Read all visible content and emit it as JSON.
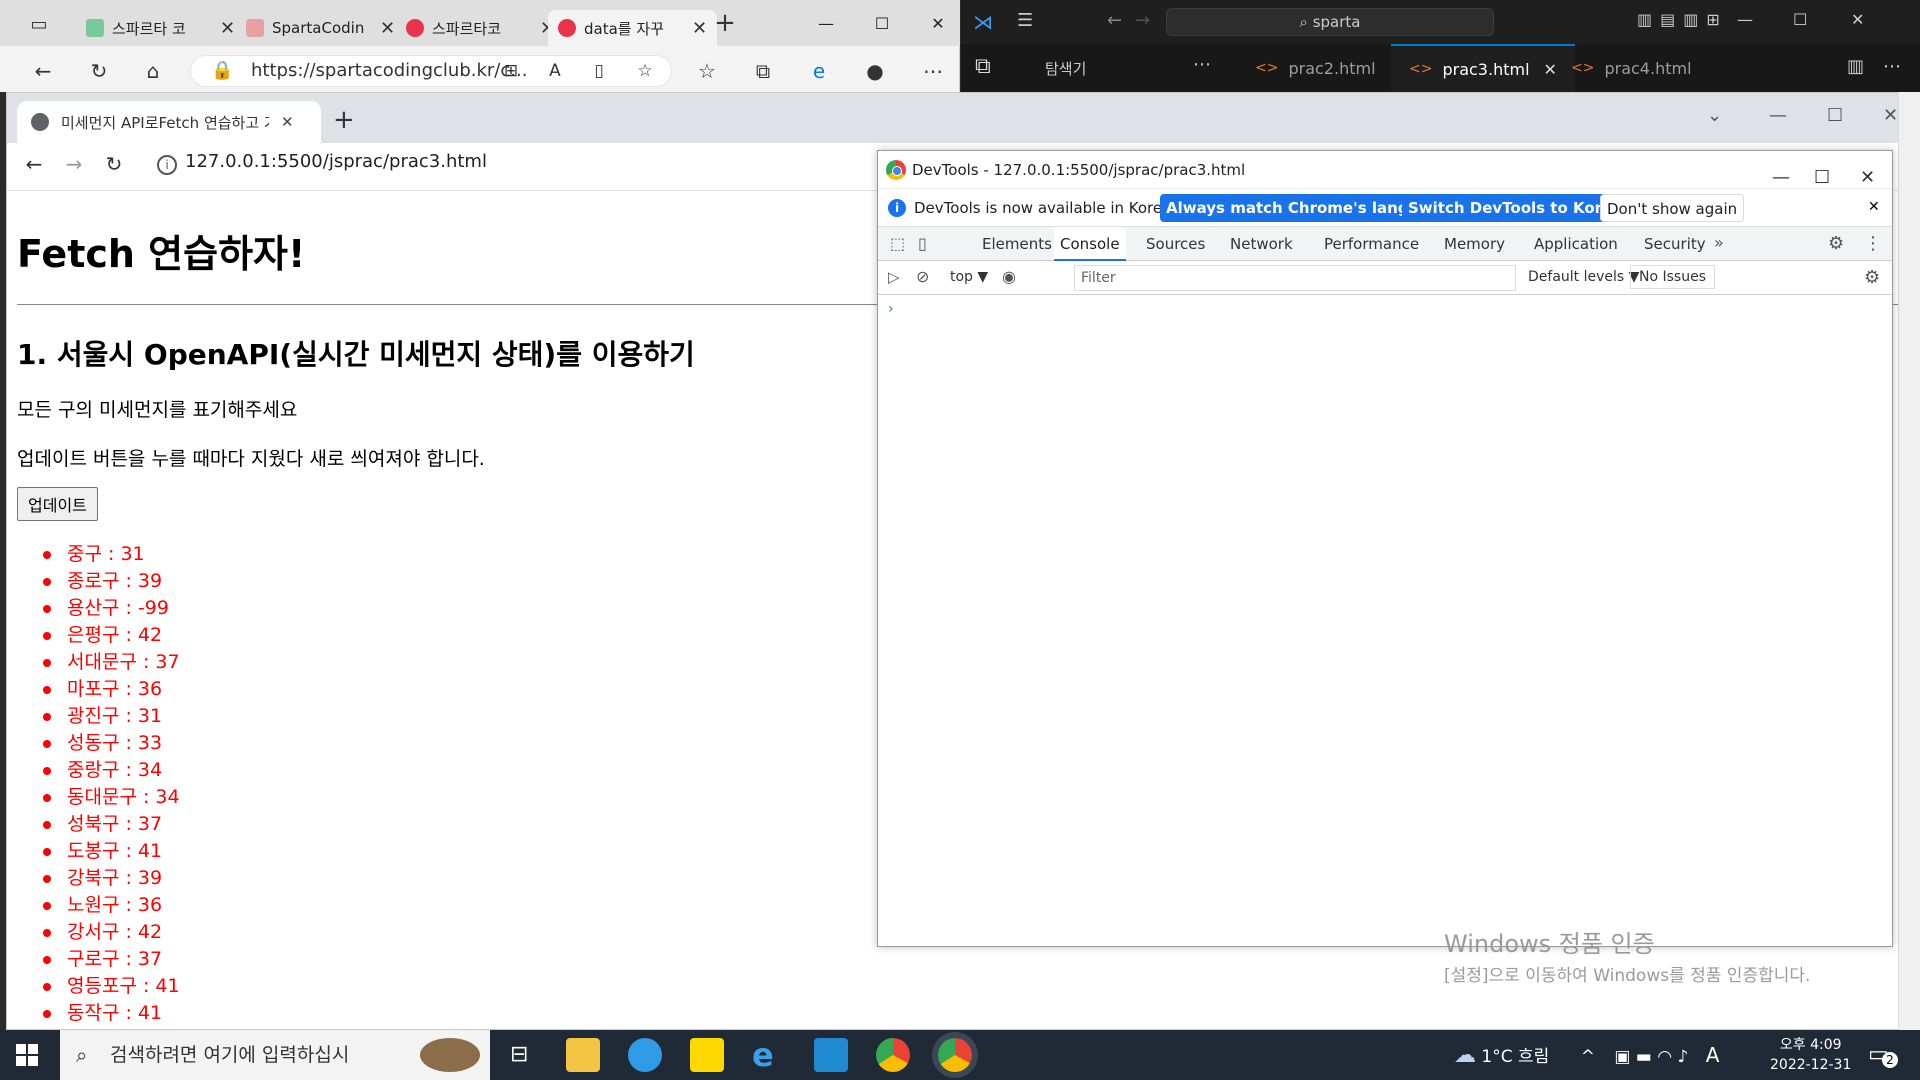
{
  "edge": {
    "tabs": [
      {
        "label": "스파르타 코",
        "color": "#77c99c"
      },
      {
        "label": "SpartaCodin",
        "color": "#e8a0a0"
      },
      {
        "label": "스파르타코",
        "color": "#e8334a"
      },
      {
        "label": "data를 자꾸",
        "color": "#e8334a"
      }
    ],
    "url": "https://spartacodingclub.kr/c..."
  },
  "vscode": {
    "search": "sparta",
    "explorer_label": "탐색기",
    "tabs": [
      {
        "label": "prac2.html"
      },
      {
        "label": "prac3.html"
      },
      {
        "label": "prac4.html"
      }
    ]
  },
  "chrome": {
    "tab_title": "미세먼지 API로Fetch 연습하고 가",
    "url": "127.0.0.1:5500/jsprac/prac3.html"
  },
  "page": {
    "h1": "Fetch 연습하자!",
    "h2": "1. 서울시 OpenAPI(실시간 미세먼지 상태)를 이용하기",
    "p1": "모든 구의 미세먼지를 표기해주세요",
    "p2": "업데이트 버튼을 누를 때마다 지웠다 새로 씌여져야 합니다.",
    "button": "업데이트",
    "items": [
      "중구 : 31",
      "종로구 : 39",
      "용산구 : -99",
      "은평구 : 42",
      "서대문구 : 37",
      "마포구 : 36",
      "광진구 : 31",
      "성동구 : 33",
      "중랑구 : 34",
      "동대문구 : 34",
      "성북구 : 37",
      "도봉구 : 41",
      "강북구 : 39",
      "노원구 : 36",
      "강서구 : 42",
      "구로구 : 37",
      "영등포구 : 41",
      "동작구 : 41"
    ]
  },
  "devtools": {
    "title": "DevTools - 127.0.0.1:5500/jsprac/prac3.html",
    "info_msg": "DevTools is now available in Korean!",
    "btn_match": "Always match Chrome's language",
    "btn_switch": "Switch DevTools to Korean",
    "btn_dont": "Don't show again",
    "panels": [
      "Elements",
      "Console",
      "Sources",
      "Network",
      "Performance",
      "Memory",
      "Application",
      "Security"
    ],
    "context": "top",
    "filter_placeholder": "Filter",
    "levels": "Default levels",
    "issues": "No Issues"
  },
  "watermark": {
    "line1": "Windows 정품 인증",
    "line2": "[설정]으로 이동하여 Windows를 정품 인증합니다."
  },
  "taskbar": {
    "search_placeholder": "검색하려면 여기에 입력하십시",
    "weather": "1°C 흐림",
    "time": "오후 4:09",
    "date": "2022-12-31",
    "notifications": "2",
    "lang": "A"
  }
}
